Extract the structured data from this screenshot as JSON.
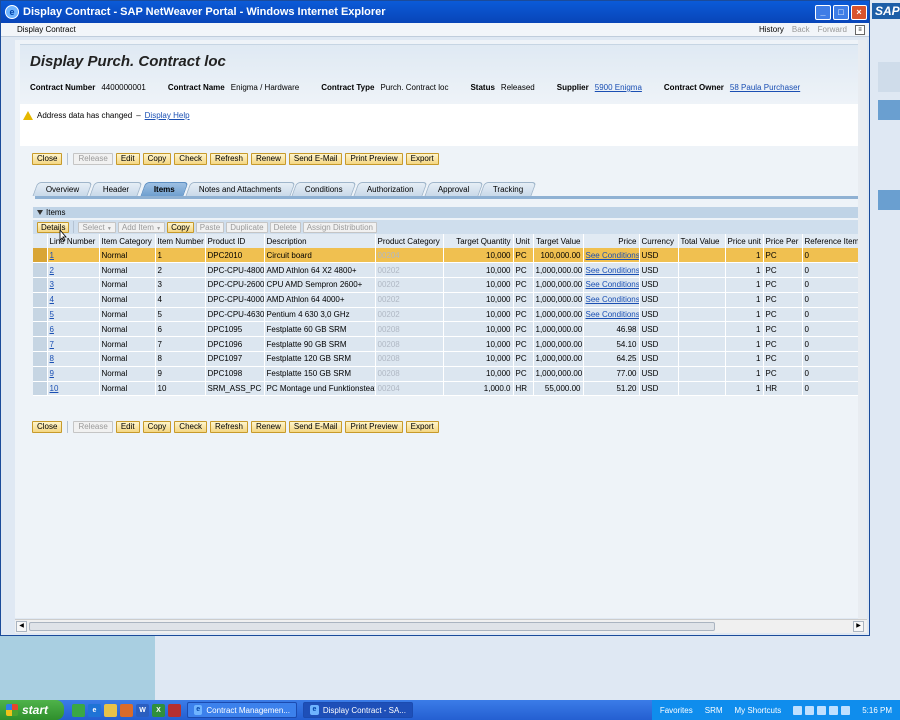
{
  "window": {
    "title": "Display Contract - SAP NetWeaver Portal - Windows Internet Explorer",
    "logo": "SAP"
  },
  "portal": {
    "page_title": "Display Contract",
    "history": "History",
    "back": "Back",
    "forward": "Forward"
  },
  "page": {
    "heading": "Display Purch. Contract loc",
    "header_fields": [
      {
        "label": "Contract Number",
        "value": "4400000001"
      },
      {
        "label": "Contract Name",
        "value": "Enigma / Hardware"
      },
      {
        "label": "Contract Type",
        "value": "Purch. Contract loc"
      },
      {
        "label": "Status",
        "value": "Released"
      }
    ],
    "supplier": {
      "label": "Supplier",
      "value": "5900 Enigma"
    },
    "owner": {
      "label": "Contract Owner",
      "value": "58 Paula Purchaser"
    },
    "message": {
      "text": "Address data has changed",
      "separator": "–",
      "link": "Display Help"
    }
  },
  "toolbar": {
    "close": "Close",
    "release": "Release",
    "edit": "Edit",
    "copy": "Copy",
    "check": "Check",
    "refresh": "Refresh",
    "renew": "Renew",
    "send_email": "Send E-Mail",
    "print_preview": "Print Preview",
    "export": "Export"
  },
  "tabs": [
    "Overview",
    "Header",
    "Items",
    "Notes and Attachments",
    "Conditions",
    "Authorization",
    "Approval",
    "Tracking"
  ],
  "items": {
    "title": "Items",
    "toolbar": {
      "details": "Details",
      "select": "Select",
      "add_item": "Add Item",
      "copy": "Copy",
      "paste": "Paste",
      "duplicate": "Duplicate",
      "delete": "Delete",
      "assign_distribution": "Assign Distribution"
    },
    "columns": [
      "Line Number",
      "Item Category",
      "Item Number",
      "Product ID",
      "Description",
      "Product Category",
      "Target Quantity",
      "Unit",
      "Target Value",
      "Price",
      "Currency",
      "Total Value",
      "Price unit",
      "Price Per",
      "Reference Item N"
    ],
    "rows": [
      [
        "1",
        "Normal",
        "1",
        "DPC2010",
        "Circuit board",
        "00204",
        "10,000",
        "PC",
        "100,000.00",
        "See Conditions",
        "USD",
        "",
        "1",
        "PC",
        "0"
      ],
      [
        "2",
        "Normal",
        "2",
        "DPC-CPU-4800",
        "AMD Athlon 64 X2 4800+",
        "00202",
        "10,000",
        "PC",
        "1,000,000.00",
        "See Conditions",
        "USD",
        "",
        "1",
        "PC",
        "0"
      ],
      [
        "3",
        "Normal",
        "3",
        "DPC-CPU-2600",
        "CPU AMD Sempron 2600+",
        "00202",
        "10,000",
        "PC",
        "1,000,000.00",
        "See Conditions",
        "USD",
        "",
        "1",
        "PC",
        "0"
      ],
      [
        "4",
        "Normal",
        "4",
        "DPC-CPU-4000",
        "AMD Athlon 64 4000+",
        "00202",
        "10,000",
        "PC",
        "1,000,000.00",
        "See Conditions",
        "USD",
        "",
        "1",
        "PC",
        "0"
      ],
      [
        "5",
        "Normal",
        "5",
        "DPC-CPU-4630",
        "Pentium 4 630 3,0 GHz",
        "00202",
        "10,000",
        "PC",
        "1,000,000.00",
        "See Conditions",
        "USD",
        "",
        "1",
        "PC",
        "0"
      ],
      [
        "6",
        "Normal",
        "6",
        "DPC1095",
        "Festplatte 60 GB SRM",
        "00208",
        "10,000",
        "PC",
        "1,000,000.00",
        "46.98",
        "USD",
        "",
        "1",
        "PC",
        "0"
      ],
      [
        "7",
        "Normal",
        "7",
        "DPC1096",
        "Festplatte 90 GB SRM",
        "00208",
        "10,000",
        "PC",
        "1,000,000.00",
        "54.10",
        "USD",
        "",
        "1",
        "PC",
        "0"
      ],
      [
        "8",
        "Normal",
        "8",
        "DPC1097",
        "Festplatte 120 GB SRM",
        "00208",
        "10,000",
        "PC",
        "1,000,000.00",
        "64.25",
        "USD",
        "",
        "1",
        "PC",
        "0"
      ],
      [
        "9",
        "Normal",
        "9",
        "DPC1098",
        "Festplatte 150 GB SRM",
        "00208",
        "10,000",
        "PC",
        "1,000,000.00",
        "77.00",
        "USD",
        "",
        "1",
        "PC",
        "0"
      ],
      [
        "10",
        "Normal",
        "10",
        "SRM_ASS_PC",
        "PC Montage und Funktionsteat",
        "00204",
        "1,000.0",
        "HR",
        "55,000.00",
        "51.20",
        "USD",
        "",
        "1",
        "HR",
        "0"
      ]
    ]
  },
  "taskbar": {
    "start": "start",
    "tasks": [
      "Contract Managemen...",
      "Display Contract - SA..."
    ],
    "tray": [
      "Favorites",
      "SRM",
      "My Shortcuts"
    ],
    "clock": "5:16 PM"
  },
  "colors": {
    "accent": "#f0c050",
    "brand": "#1d5fa8",
    "link": "#1a4fb3"
  }
}
